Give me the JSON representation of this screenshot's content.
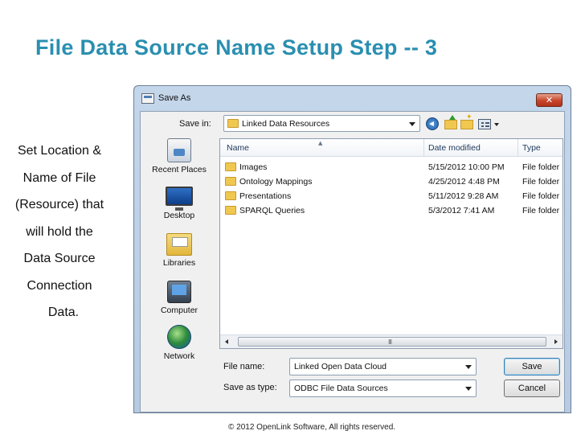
{
  "slide": {
    "title": "File Data Source Name Setup Step -- 3",
    "side_text_lines": [
      "Set Location &",
      "Name of File",
      "(Resource) that",
      "will hold the",
      "Data Source",
      "Connection",
      "Data."
    ],
    "footer": "© 2012 OpenLink Software, All rights reserved."
  },
  "dialog": {
    "title": "Save As",
    "close_glyph": "✕",
    "save_in_label": "Save in:",
    "save_in_value": "Linked Data Resources",
    "places": [
      {
        "label": "Recent Places",
        "icon": "recent-places-icon"
      },
      {
        "label": "Desktop",
        "icon": "desktop-icon"
      },
      {
        "label": "Libraries",
        "icon": "libraries-icon"
      },
      {
        "label": "Computer",
        "icon": "computer-icon"
      },
      {
        "label": "Network",
        "icon": "network-icon"
      }
    ],
    "columns": {
      "name": "Name",
      "date": "Date modified",
      "type": "Type"
    },
    "files": [
      {
        "name": "Images",
        "date": "5/15/2012 10:00 PM",
        "type": "File folder"
      },
      {
        "name": "Ontology Mappings",
        "date": "4/25/2012 4:48 PM",
        "type": "File folder"
      },
      {
        "name": "Presentations",
        "date": "5/11/2012 9:28 AM",
        "type": "File folder"
      },
      {
        "name": "SPARQL Queries",
        "date": "5/3/2012 7:41 AM",
        "type": "File folder"
      }
    ],
    "scroll_grip": "III",
    "file_name_label": "File name:",
    "file_name_value": "Linked Open Data Cloud",
    "save_as_type_label": "Save as type:",
    "save_as_type_value": "ODBC File Data Sources",
    "save_button": "Save",
    "cancel_button": "Cancel"
  }
}
